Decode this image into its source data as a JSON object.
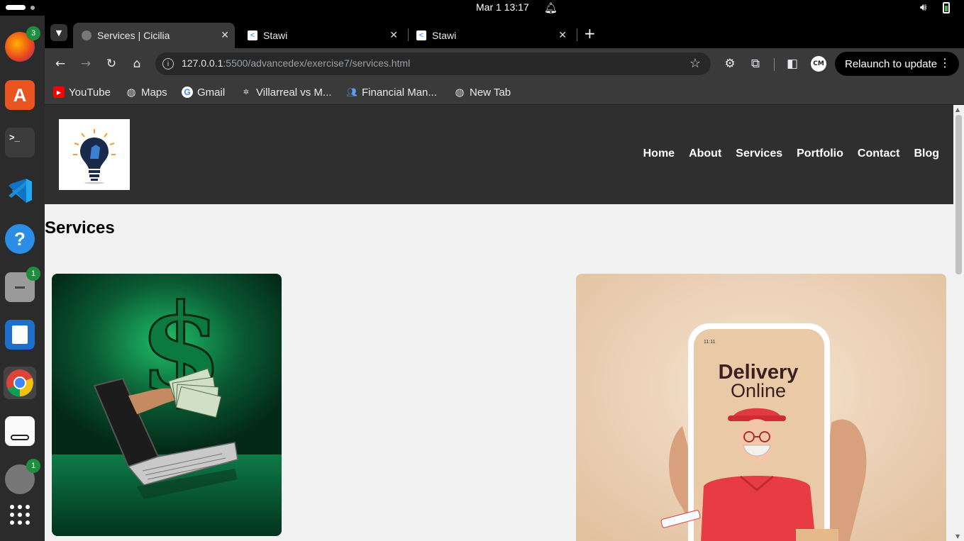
{
  "topbar": {
    "clock": "Mar 1  13:17"
  },
  "dock": {
    "items": [
      {
        "name": "firefox",
        "badge": "3"
      },
      {
        "name": "app-center",
        "badge": ""
      },
      {
        "name": "terminal",
        "badge": ""
      },
      {
        "name": "vscode",
        "badge": ""
      },
      {
        "name": "help",
        "badge": ""
      },
      {
        "name": "files",
        "badge": "1"
      },
      {
        "name": "writer",
        "badge": ""
      },
      {
        "name": "chrome",
        "badge": ""
      },
      {
        "name": "document-viewer",
        "badge": ""
      },
      {
        "name": "screenshot",
        "badge": "1"
      },
      {
        "name": "app-grid",
        "badge": ""
      }
    ]
  },
  "tabs": [
    {
      "title": "Services | Cicilia",
      "active": true
    },
    {
      "title": "Stawi",
      "active": false
    },
    {
      "title": "Stawi",
      "active": false
    }
  ],
  "omnibox": {
    "host": "127.0.0.1",
    "path": ":5500/advancedex/exercise7/services.html"
  },
  "profile": {
    "initials": "CM"
  },
  "relaunch": {
    "label": "Relaunch to update"
  },
  "bookmarks": [
    {
      "label": "YouTube",
      "icon": "youtube-icon"
    },
    {
      "label": "Maps",
      "icon": "globe-icon"
    },
    {
      "label": "Gmail",
      "icon": "google-icon"
    },
    {
      "label": "Villarreal vs M...",
      "icon": "soccer-icon"
    },
    {
      "label": "Financial Man...",
      "icon": "people-icon"
    },
    {
      "label": "New Tab",
      "icon": "globe-icon"
    }
  ],
  "site": {
    "nav": [
      "Home",
      "About",
      "Services",
      "Portfolio",
      "Contact",
      "Blog"
    ],
    "heading": "Services",
    "delivery_text_1": "Delivery",
    "delivery_text_2": "Online",
    "phone_time": "11:11"
  },
  "colors": {
    "header_bg": "#2f2f2f",
    "page_bg": "#f2f2f2",
    "accent_green": "#0c6b3c",
    "delivery_bg": "#e8c9a8"
  }
}
